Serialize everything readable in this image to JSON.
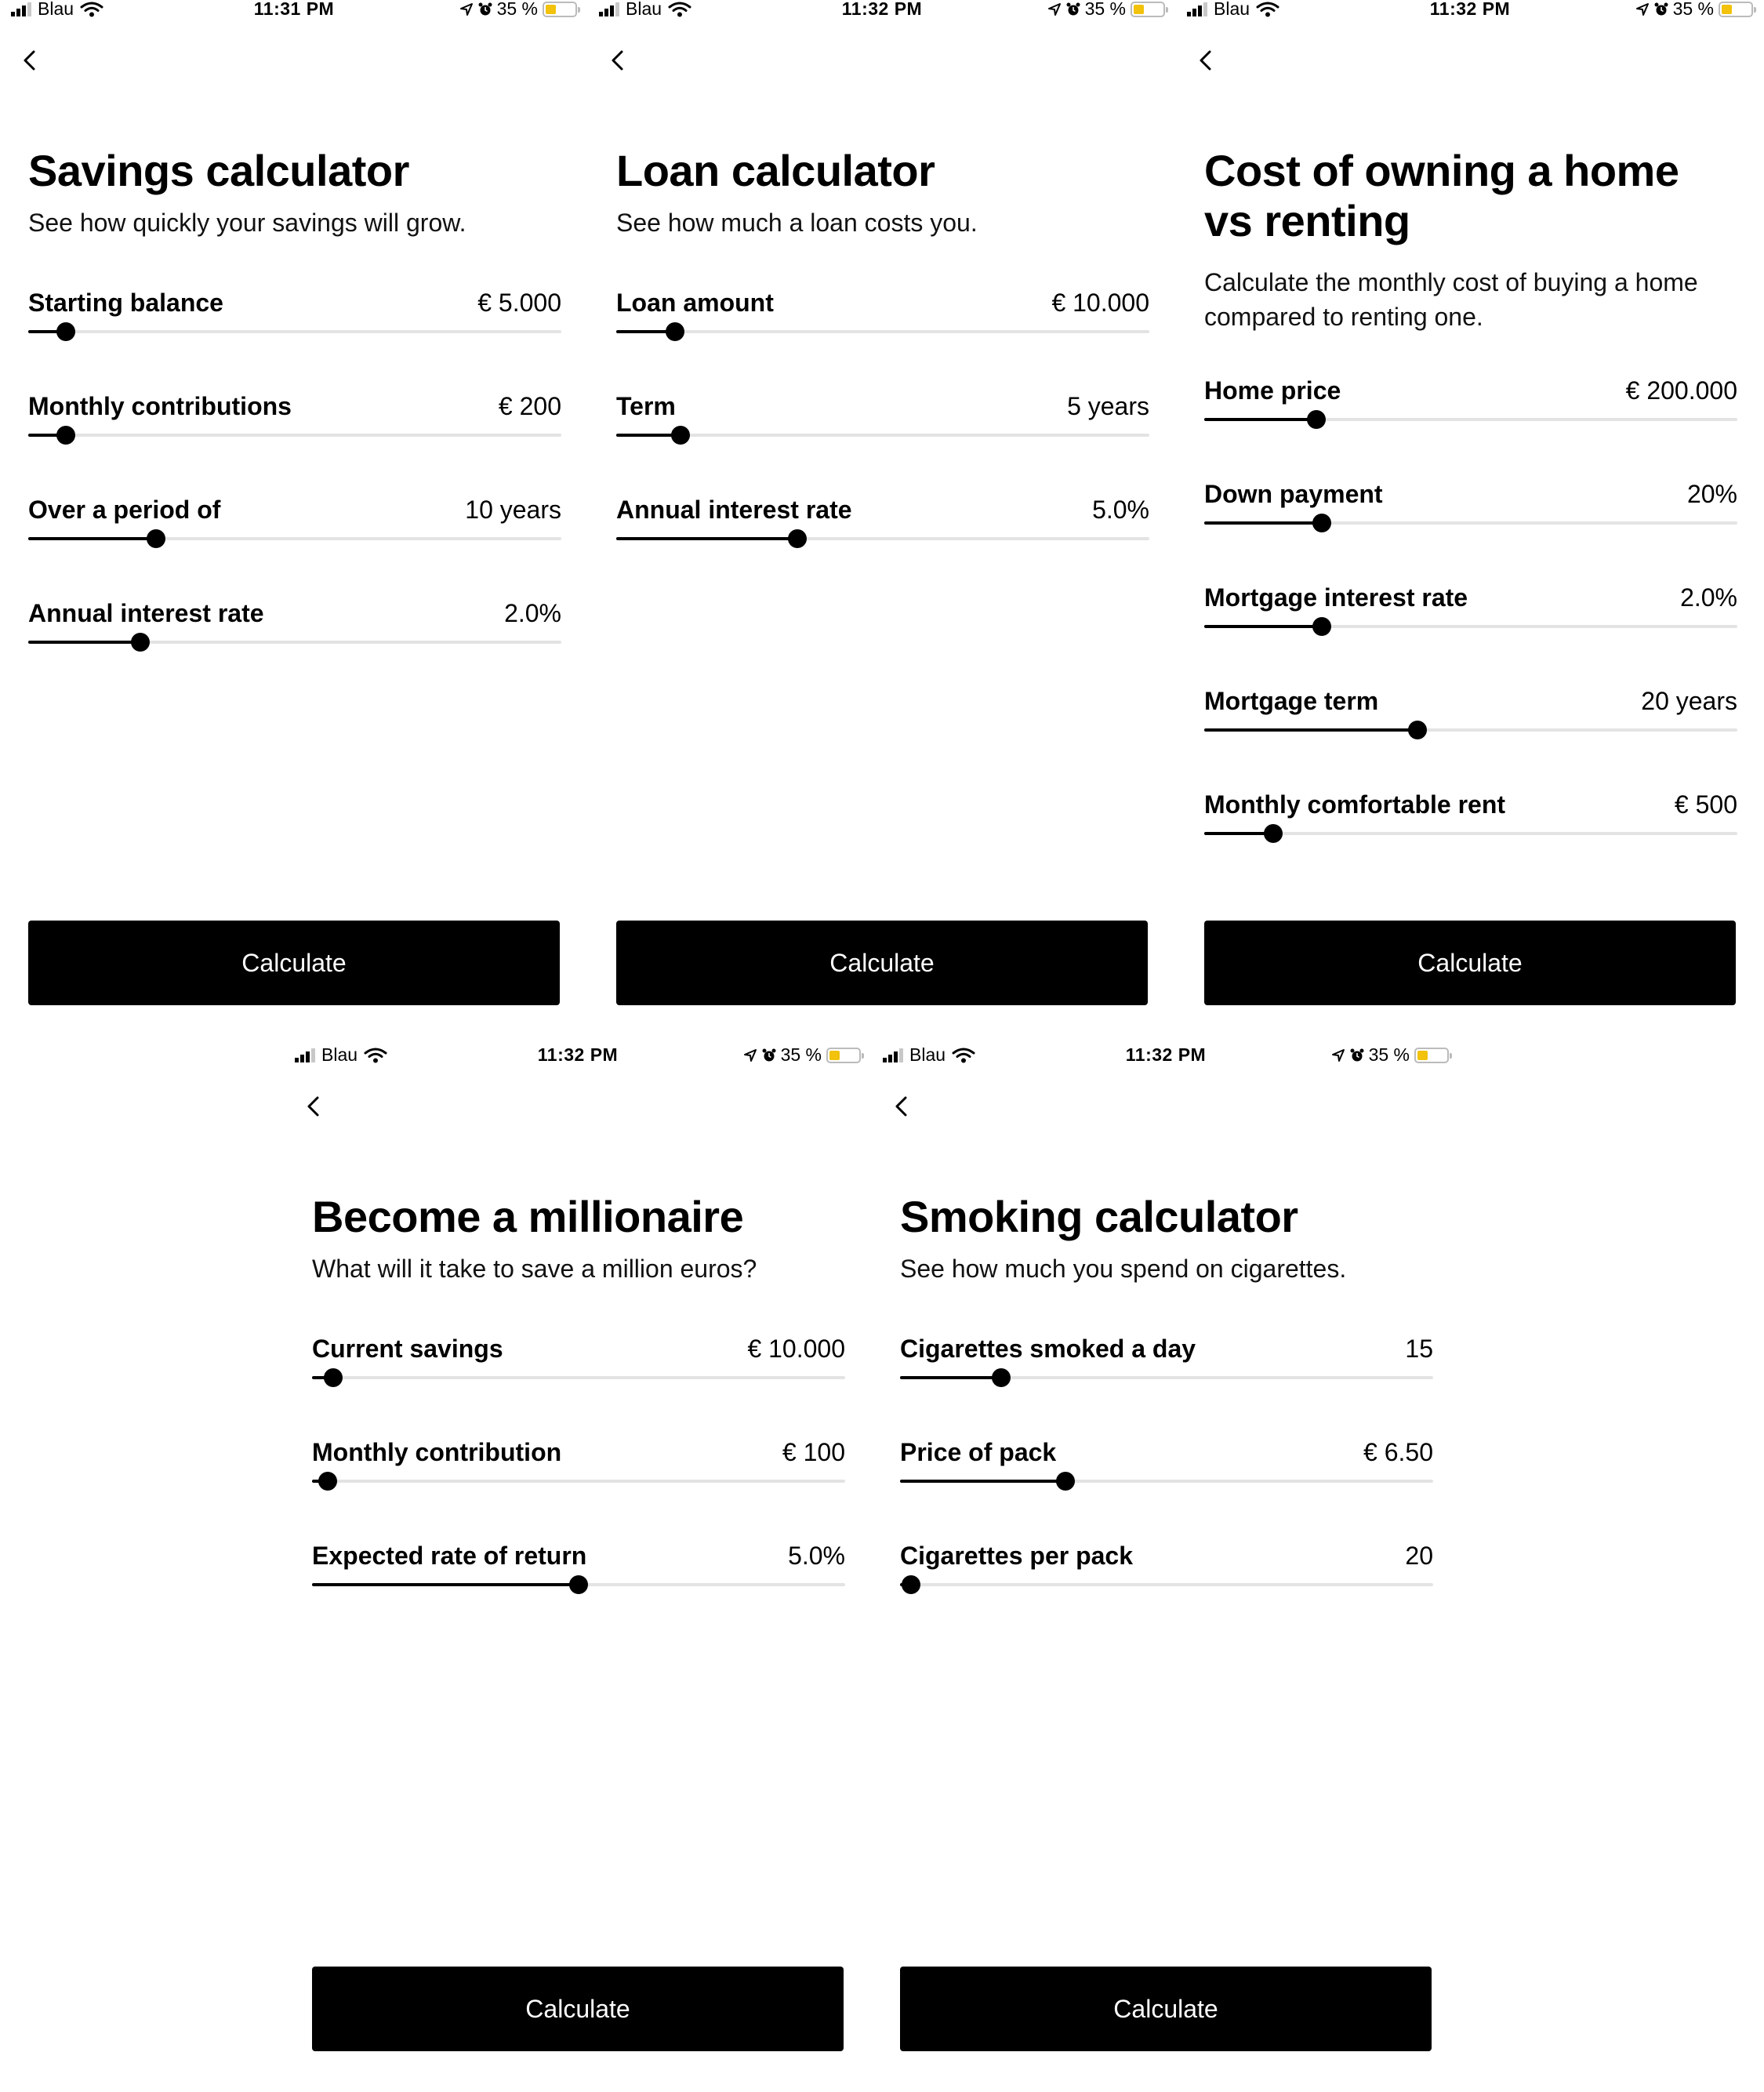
{
  "statusbar": {
    "carrier": "Blau",
    "battery": "35 %",
    "battery_level": 0.35,
    "icons": [
      "signal-bars-icon",
      "wifi-icon",
      "location-arrow-icon",
      "alarm-clock-icon",
      "battery-icon"
    ]
  },
  "screens": [
    {
      "time": "11:31 PM",
      "title": "Savings calculator",
      "subtitle": "See how quickly your savings will grow.",
      "fields": [
        {
          "label": "Starting balance",
          "value": "€ 5.000",
          "slider_fraction": 0.07
        },
        {
          "label": "Monthly contributions",
          "value": "€ 200",
          "slider_fraction": 0.07
        },
        {
          "label": "Over a period of",
          "value": "10 years",
          "slider_fraction": 0.24
        },
        {
          "label": "Annual interest rate",
          "value": "2.0%",
          "slider_fraction": 0.21
        }
      ],
      "button": "Calculate"
    },
    {
      "time": "11:32 PM",
      "title": "Loan calculator",
      "subtitle": "See how much a loan costs you.",
      "fields": [
        {
          "label": "Loan amount",
          "value": "€ 10.000",
          "slider_fraction": 0.11
        },
        {
          "label": "Term",
          "value": "5 years",
          "slider_fraction": 0.12
        },
        {
          "label": "Annual interest rate",
          "value": "5.0%",
          "slider_fraction": 0.34
        }
      ],
      "button": "Calculate"
    },
    {
      "time": "11:32 PM",
      "title": "Cost of owning a home vs renting",
      "subtitle": "Calculate the monthly cost of buying a home compared to renting one.",
      "fields": [
        {
          "label": "Home price",
          "value": "€ 200.000",
          "slider_fraction": 0.21
        },
        {
          "label": "Down payment",
          "value": "20%",
          "slider_fraction": 0.22
        },
        {
          "label": "Mortgage interest rate",
          "value": "2.0%",
          "slider_fraction": 0.22
        },
        {
          "label": "Mortgage term",
          "value": "20 years",
          "slider_fraction": 0.4
        },
        {
          "label": "Monthly comfortable rent",
          "value": "€ 500",
          "slider_fraction": 0.13
        }
      ],
      "button": "Calculate"
    },
    {
      "time": "11:32 PM",
      "title": "Become a millionaire",
      "subtitle": "What will it take to save a million euros?",
      "fields": [
        {
          "label": "Current savings",
          "value": "€ 10.000",
          "slider_fraction": 0.04
        },
        {
          "label": "Monthly contribution",
          "value": "€ 100",
          "slider_fraction": 0.03
        },
        {
          "label": "Expected rate of return",
          "value": "5.0%",
          "slider_fraction": 0.5
        }
      ],
      "button": "Calculate"
    },
    {
      "time": "11:32 PM",
      "title": "Smoking calculator",
      "subtitle": "See how much you spend on cigarettes.",
      "fields": [
        {
          "label": "Cigarettes smoked a day",
          "value": "15",
          "slider_fraction": 0.19
        },
        {
          "label": "Price of pack",
          "value": "€ 6.50",
          "slider_fraction": 0.31
        },
        {
          "label": "Cigarettes per pack",
          "value": "20",
          "slider_fraction": 0.02
        }
      ],
      "button": "Calculate"
    }
  ]
}
